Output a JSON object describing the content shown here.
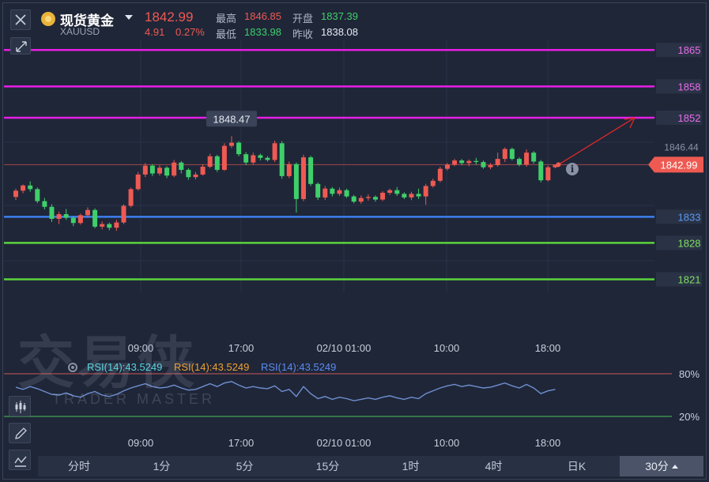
{
  "header": {
    "instrument_name": "现货黄金",
    "instrument_code": "XAUUSD",
    "price": "1842.99",
    "change": "4.91",
    "change_pct": "0.27%",
    "high_label": "最高",
    "high_value": "1846.85",
    "low_label": "最低",
    "low_value": "1833.98",
    "open_label": "开盘",
    "open_value": "1837.39",
    "prev_close_label": "昨收",
    "prev_close_value": "1838.08"
  },
  "watermark": {
    "cn": "交易侠",
    "en": "TRADER MASTER"
  },
  "rsi": {
    "legend": [
      "RSI(14):43.5249",
      "RSI(14):43.5249",
      "RSI(14):43.5249"
    ],
    "upper_label": "80%",
    "lower_label": "20%"
  },
  "tabs": [
    {
      "label": "分时",
      "active": false
    },
    {
      "label": "1分",
      "active": false
    },
    {
      "label": "5分",
      "active": false
    },
    {
      "label": "15分",
      "active": false
    },
    {
      "label": "1时",
      "active": false
    },
    {
      "label": "4时",
      "active": false
    },
    {
      "label": "日K",
      "active": false
    },
    {
      "label": "30分",
      "active": true
    }
  ],
  "colors": {
    "up": "#ee5a52",
    "down": "#3fcf6a",
    "magenta": "#e61ee6",
    "blue": "#3c7ff0",
    "green": "#5ad43c",
    "rsi": "#6f8fd0"
  },
  "chart_data": {
    "type": "candlestick",
    "ylim": [
      1818.5,
      1867
    ],
    "current_price": 1842.99,
    "peak_label": "1848.47",
    "right_gray_labels": [
      "1846.44"
    ],
    "x_tick_labels": [
      "09:00",
      "17:00",
      "02/10 01:00",
      "10:00",
      "18:00"
    ],
    "horizontal_levels": [
      {
        "value": 1865,
        "label": "1865",
        "color": "magenta"
      },
      {
        "value": 1858,
        "label": "1858",
        "color": "magenta"
      },
      {
        "value": 1852,
        "label": "1852",
        "color": "magenta"
      },
      {
        "value": 1833,
        "label": "1833",
        "color": "blue"
      },
      {
        "value": 1828,
        "label": "1828",
        "color": "green"
      },
      {
        "value": 1821,
        "label": "1821",
        "color": "green"
      }
    ],
    "candles": [
      [
        1836.8,
        1838.4,
        1836.2,
        1838.0
      ],
      [
        1838.0,
        1839.2,
        1837.5,
        1839.0
      ],
      [
        1839.0,
        1839.8,
        1837.8,
        1838.3
      ],
      [
        1838.3,
        1838.6,
        1835.6,
        1836.0
      ],
      [
        1836.0,
        1836.6,
        1834.4,
        1834.9
      ],
      [
        1834.9,
        1835.4,
        1832.0,
        1832.6
      ],
      [
        1832.6,
        1834.0,
        1831.6,
        1833.5
      ],
      [
        1833.5,
        1834.5,
        1832.4,
        1832.8
      ],
      [
        1832.8,
        1833.1,
        1831.2,
        1831.8
      ],
      [
        1831.8,
        1833.6,
        1831.5,
        1833.3
      ],
      [
        1833.3,
        1834.8,
        1832.9,
        1834.3
      ],
      [
        1834.3,
        1834.6,
        1830.8,
        1831.1
      ],
      [
        1831.1,
        1832.1,
        1830.6,
        1831.6
      ],
      [
        1831.6,
        1831.9,
        1830.4,
        1830.9
      ],
      [
        1830.9,
        1832.4,
        1830.3,
        1831.9
      ],
      [
        1831.9,
        1835.4,
        1831.6,
        1835.1
      ],
      [
        1835.1,
        1838.6,
        1834.8,
        1838.3
      ],
      [
        1838.3,
        1841.6,
        1838.0,
        1841.1
      ],
      [
        1841.1,
        1843.3,
        1840.6,
        1842.8
      ],
      [
        1842.8,
        1843.1,
        1840.8,
        1841.3
      ],
      [
        1841.3,
        1842.9,
        1840.9,
        1842.4
      ],
      [
        1842.4,
        1842.7,
        1840.4,
        1840.9
      ],
      [
        1840.9,
        1843.9,
        1840.6,
        1843.4
      ],
      [
        1843.4,
        1843.7,
        1841.3,
        1842.0
      ],
      [
        1842.0,
        1842.3,
        1840.1,
        1840.6
      ],
      [
        1840.6,
        1841.6,
        1840.2,
        1841.1
      ],
      [
        1841.1,
        1843.1,
        1840.9,
        1842.6
      ],
      [
        1842.6,
        1845.1,
        1842.3,
        1844.6
      ],
      [
        1844.6,
        1844.9,
        1841.6,
        1842.0
      ],
      [
        1842.0,
        1847.1,
        1841.8,
        1846.6
      ],
      [
        1846.6,
        1848.47,
        1846.2,
        1847.2
      ],
      [
        1847.2,
        1847.5,
        1844.6,
        1845.0
      ],
      [
        1845.0,
        1845.4,
        1842.9,
        1843.4
      ],
      [
        1843.4,
        1845.3,
        1843.0,
        1844.8
      ],
      [
        1844.8,
        1845.1,
        1843.8,
        1844.3
      ],
      [
        1844.3,
        1844.6,
        1843.6,
        1843.9
      ],
      [
        1843.9,
        1847.6,
        1843.5,
        1847.1
      ],
      [
        1847.1,
        1847.5,
        1840.3,
        1840.8
      ],
      [
        1840.8,
        1843.6,
        1840.4,
        1843.1
      ],
      [
        1843.1,
        1843.4,
        1833.8,
        1836.4
      ],
      [
        1836.4,
        1844.9,
        1836.0,
        1844.4
      ],
      [
        1844.4,
        1844.7,
        1838.9,
        1839.3
      ],
      [
        1839.3,
        1839.6,
        1836.2,
        1836.7
      ],
      [
        1836.7,
        1838.9,
        1836.2,
        1838.4
      ],
      [
        1838.4,
        1838.7,
        1836.9,
        1837.4
      ],
      [
        1837.4,
        1838.6,
        1837.0,
        1838.1
      ],
      [
        1838.1,
        1838.4,
        1836.6,
        1836.9
      ],
      [
        1836.9,
        1837.2,
        1835.6,
        1835.9
      ],
      [
        1835.9,
        1837.1,
        1835.5,
        1836.6
      ],
      [
        1836.6,
        1837.3,
        1836.1,
        1836.8
      ],
      [
        1836.8,
        1837.1,
        1835.9,
        1836.3
      ],
      [
        1836.3,
        1837.9,
        1836.0,
        1837.6
      ],
      [
        1837.6,
        1838.4,
        1837.2,
        1838.1
      ],
      [
        1838.1,
        1838.7,
        1837.0,
        1837.4
      ],
      [
        1837.4,
        1837.7,
        1836.4,
        1836.7
      ],
      [
        1836.7,
        1837.8,
        1836.2,
        1837.4
      ],
      [
        1837.4,
        1838.4,
        1836.4,
        1836.9
      ],
      [
        1836.9,
        1839.3,
        1835.3,
        1838.9
      ],
      [
        1838.9,
        1840.3,
        1838.6,
        1839.9
      ],
      [
        1839.9,
        1842.6,
        1839.6,
        1842.2
      ],
      [
        1842.2,
        1843.3,
        1841.9,
        1843.0
      ],
      [
        1843.0,
        1844.1,
        1842.7,
        1843.8
      ],
      [
        1843.8,
        1844.1,
        1842.9,
        1843.3
      ],
      [
        1843.3,
        1844.0,
        1842.7,
        1843.7
      ],
      [
        1843.7,
        1844.3,
        1843.0,
        1843.5
      ],
      [
        1843.5,
        1843.8,
        1842.2,
        1842.5
      ],
      [
        1842.5,
        1843.3,
        1842.1,
        1842.9
      ],
      [
        1842.9,
        1845.3,
        1842.6,
        1844.1
      ],
      [
        1844.1,
        1846.3,
        1843.5,
        1846.0
      ],
      [
        1846.0,
        1846.3,
        1843.8,
        1844.1
      ],
      [
        1844.1,
        1844.4,
        1842.7,
        1843.0
      ],
      [
        1843.0,
        1845.9,
        1842.6,
        1845.3
      ],
      [
        1845.3,
        1845.6,
        1843.2,
        1843.6
      ],
      [
        1843.6,
        1843.9,
        1839.6,
        1840.0
      ],
      [
        1840.0,
        1842.8,
        1839.8,
        1842.5
      ],
      [
        1842.5,
        1842.99,
        1842.3,
        1842.99
      ]
    ],
    "rsi_ylim": [
      0,
      100
    ],
    "rsi_values": [
      61,
      58,
      62,
      59,
      55,
      51,
      50,
      53,
      49,
      47,
      52,
      55,
      50,
      48,
      51,
      56,
      60,
      63,
      66,
      62,
      60,
      61,
      64,
      60,
      57,
      58,
      62,
      66,
      62,
      67,
      69,
      64,
      60,
      62,
      60,
      59,
      63,
      55,
      58,
      48,
      62,
      52,
      45,
      48,
      44,
      47,
      45,
      42,
      44,
      46,
      44,
      47,
      49,
      46,
      44,
      47,
      45,
      52,
      56,
      60,
      63,
      65,
      62,
      64,
      62,
      60,
      61,
      64,
      67,
      63,
      60,
      65,
      60,
      52,
      56,
      58
    ]
  }
}
